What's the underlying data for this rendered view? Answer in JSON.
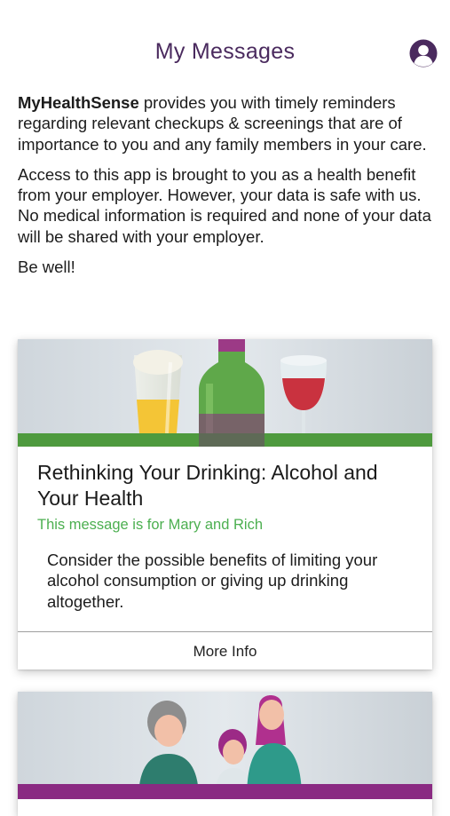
{
  "header": {
    "title": "My Messages",
    "account_icon": "user-circle-icon"
  },
  "intro": {
    "brand": "MyHealthSense",
    "paragraph1_rest": " provides you with timely reminders regarding relevant checkups & screenings that are of importance to you and any family members in your care.",
    "paragraph2": "Access to this app is brought to you as a health benefit from your employer. However, your data is safe with us. No medical information is required and none of your data will be shared with your employer.",
    "paragraph3": "Be well!"
  },
  "cards": [
    {
      "image_icon": "drinks-illustration",
      "title": "Rethinking Your Drinking: Alcohol and Your Health",
      "recipients": "This message is for Mary and Rich",
      "description": "Consider the possible benefits of limiting your alcohol consumption or giving up drinking altogether.",
      "button_label": "More Info"
    },
    {
      "image_icon": "family-illustration"
    }
  ],
  "colors": {
    "title": "#4a2a5e",
    "accent_green": "#4caf50",
    "accent_purple": "#8a2a82"
  }
}
